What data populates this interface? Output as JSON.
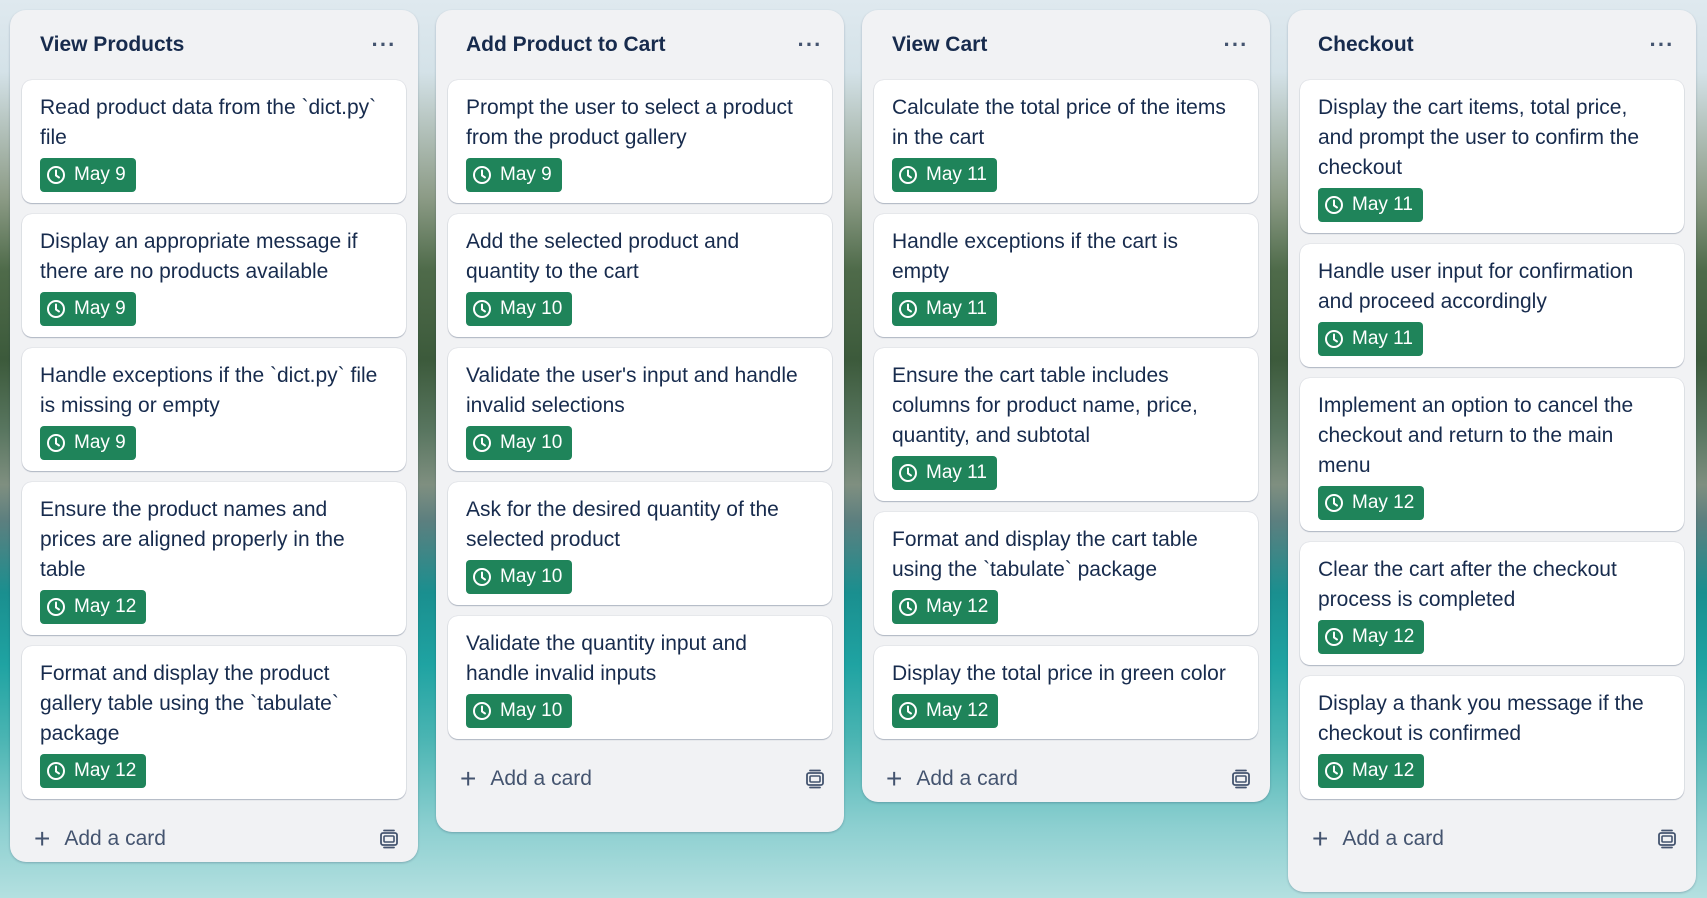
{
  "lists": [
    {
      "title": "View Products",
      "cards": [
        {
          "text": "Read product data from the `dict.py` file",
          "due": "May 9"
        },
        {
          "text": "Display an appropriate message if there are no products available",
          "due": "May 9"
        },
        {
          "text": "Handle exceptions if the `dict.py` file is missing or empty",
          "due": "May 9"
        },
        {
          "text": "Ensure the product names and prices are aligned properly in the table",
          "due": "May 12"
        },
        {
          "text": "Format and display the product gallery table using the `tabulate` package",
          "due": "May 12"
        }
      ]
    },
    {
      "title": "Add Product to Cart",
      "cards": [
        {
          "text": "Prompt the user to select a product from the product gallery",
          "due": "May 9"
        },
        {
          "text": "Add the selected product and quantity to the cart",
          "due": "May 10"
        },
        {
          "text": "Validate the user's input and handle invalid selections",
          "due": "May 10"
        },
        {
          "text": "Ask for the desired quantity of the selected product",
          "due": "May 10"
        },
        {
          "text": "Validate the quantity input and handle invalid inputs",
          "due": "May 10"
        }
      ]
    },
    {
      "title": "View Cart",
      "cards": [
        {
          "text": "Calculate the total price of the items in the cart",
          "due": "May 11"
        },
        {
          "text": "Handle exceptions if the cart is empty",
          "due": "May 11"
        },
        {
          "text": "Ensure the cart table includes columns for product name, price, quantity, and subtotal",
          "due": "May 11"
        },
        {
          "text": "Format and display the cart table using the `tabulate` package",
          "due": "May 12"
        },
        {
          "text": "Display the total price in green color",
          "due": "May 12"
        }
      ]
    },
    {
      "title": "Checkout",
      "cards": [
        {
          "text": "Display the cart items, total price, and prompt the user to confirm the checkout",
          "due": "May 11"
        },
        {
          "text": "Handle user input for confirmation and proceed accordingly",
          "due": "May 11"
        },
        {
          "text": "Implement an option to cancel the checkout and return to the main menu",
          "due": "May 12"
        },
        {
          "text": "Clear the cart after the checkout process is completed",
          "due": "May 12"
        },
        {
          "text": "Display a thank you message if the checkout is confirmed",
          "due": "May 12"
        }
      ]
    }
  ],
  "add_card_label": "Add a card",
  "menu_label": "···",
  "colors": {
    "badge_bg": "#1f845a",
    "list_bg": "#f1f2f4",
    "text": "#172b4d"
  },
  "icons": {
    "badge": "clock-icon",
    "menu": "more-icon",
    "add": "plus-icon",
    "template": "template-icon"
  }
}
